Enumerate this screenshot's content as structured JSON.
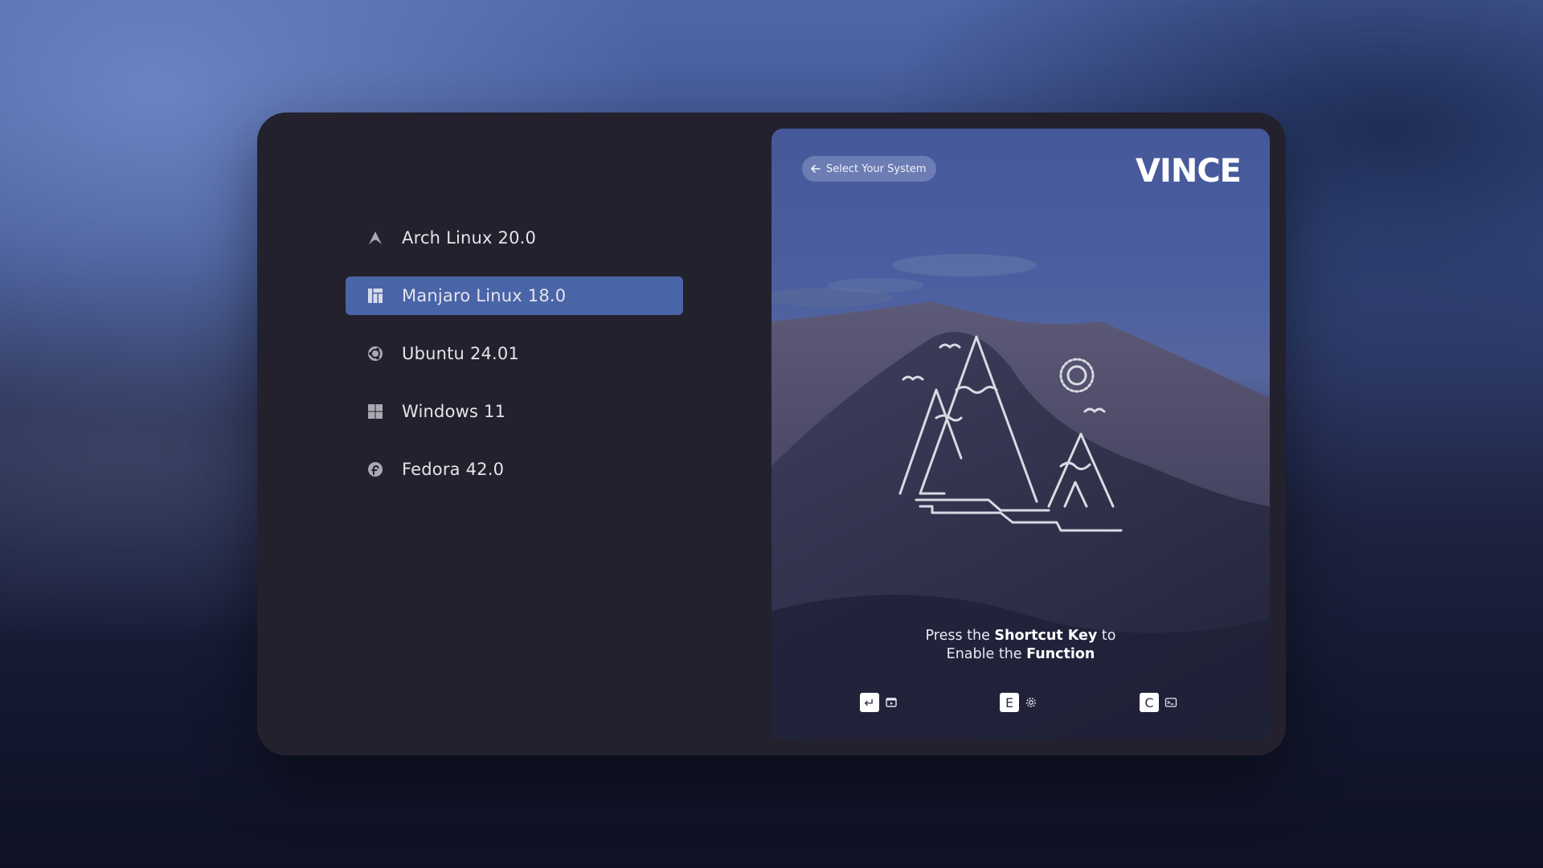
{
  "os_list": [
    {
      "label": "Arch Linux 20.0",
      "icon": "arch-icon",
      "selected": false
    },
    {
      "label": "Manjaro Linux 18.0",
      "icon": "manjaro-icon",
      "selected": true
    },
    {
      "label": "Ubuntu 24.01",
      "icon": "ubuntu-icon",
      "selected": false
    },
    {
      "label": "Windows 11",
      "icon": "windows-icon",
      "selected": false
    },
    {
      "label": "Fedora 42.0",
      "icon": "fedora-icon",
      "selected": false
    }
  ],
  "preview": {
    "back_label": "Select Your System",
    "logo_text": "VINCE",
    "hint_line1_pre": "Press the ",
    "hint_line1_bold": "Shortcut Key",
    "hint_line1_post": " to",
    "hint_line2_pre": "Enable the ",
    "hint_line2_bold": "Function",
    "shortcuts": [
      {
        "key": "↵",
        "function_icon": "boot-window-icon"
      },
      {
        "key": "E",
        "function_icon": "settings-icon"
      },
      {
        "key": "C",
        "function_icon": "terminal-icon"
      }
    ]
  },
  "colors": {
    "accent": "#4a64a8",
    "panel": "#22212d",
    "text": "#e4e4ea"
  }
}
